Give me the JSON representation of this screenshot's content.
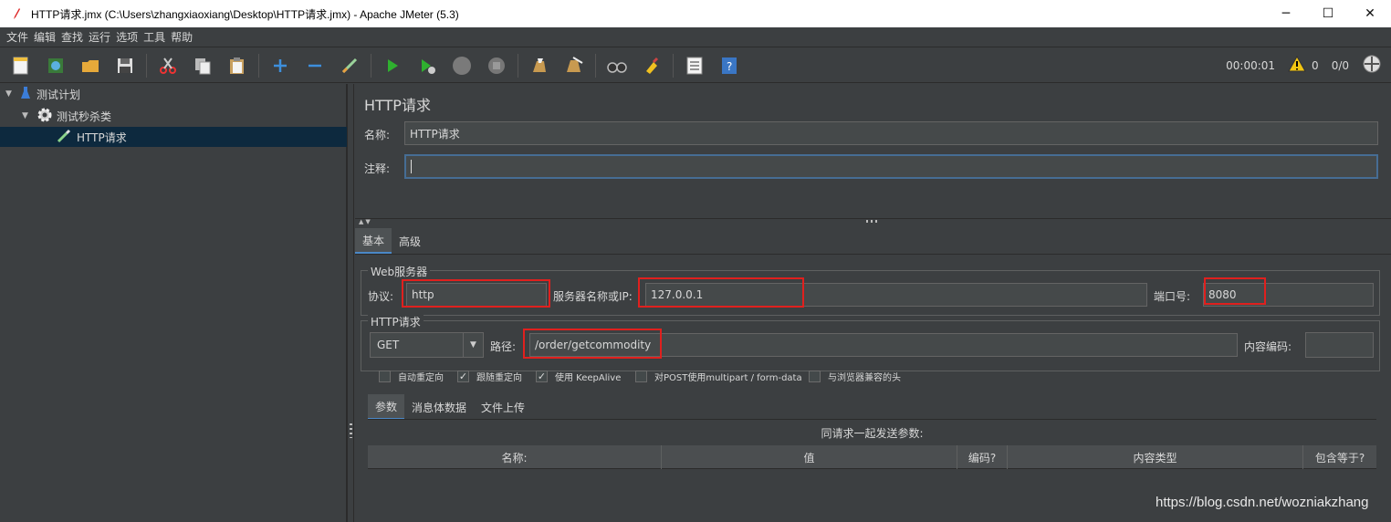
{
  "window": {
    "title": "HTTP请求.jmx (C:\\Users\\zhangxiaoxiang\\Desktop\\HTTP请求.jmx) - Apache JMeter (5.3)",
    "minimize": "─",
    "maximize": "☐",
    "close": "✕"
  },
  "menu": [
    "文件",
    "编辑",
    "查找",
    "运行",
    "选项",
    "工具",
    "帮助"
  ],
  "toolbar": {
    "timer": "00:00:01",
    "warnings": "0",
    "threads": "0/0"
  },
  "tree": {
    "items": [
      {
        "label": "测试计划"
      },
      {
        "label": "测试秒杀类"
      },
      {
        "label": "HTTP请求"
      }
    ]
  },
  "panel": {
    "title": "HTTP请求",
    "name_label": "名称:",
    "name_value": "HTTP请求",
    "comment_label": "注释:",
    "comment_value": "",
    "tabs": [
      "基本",
      "高级"
    ],
    "web_server": {
      "group_title": "Web服务器",
      "protocol_label": "协议:",
      "protocol_value": "http",
      "server_label": "服务器名称或IP:",
      "server_value": "127.0.0.1",
      "port_label": "端口号:",
      "port_value": "8080"
    },
    "http_request": {
      "group_title": "HTTP请求",
      "method": "GET",
      "path_label": "路径:",
      "path_value": "/order/getcommodity",
      "encoding_label": "内容编码:",
      "encoding_value": ""
    },
    "checkboxes": [
      {
        "label": "自动重定向",
        "checked": false
      },
      {
        "label": "跟随重定向",
        "checked": true
      },
      {
        "label": "使用 KeepAlive",
        "checked": true
      },
      {
        "label": "对POST使用multipart / form-data",
        "checked": false
      },
      {
        "label": "与浏览器兼容的头",
        "checked": false
      }
    ],
    "subtabs": [
      "参数",
      "消息体数据",
      "文件上传"
    ],
    "params_caption": "同请求一起发送参数:",
    "table_headers": [
      "名称:",
      "值",
      "编码?",
      "内容类型",
      "包含等于?"
    ]
  },
  "watermark": "https://blog.csdn.net/wozniakzhang",
  "colors": {
    "background": "#3c3f41",
    "selected_tree": "#0d293e",
    "highlight_box": "#e0201e",
    "focus_border": "#466d94"
  }
}
